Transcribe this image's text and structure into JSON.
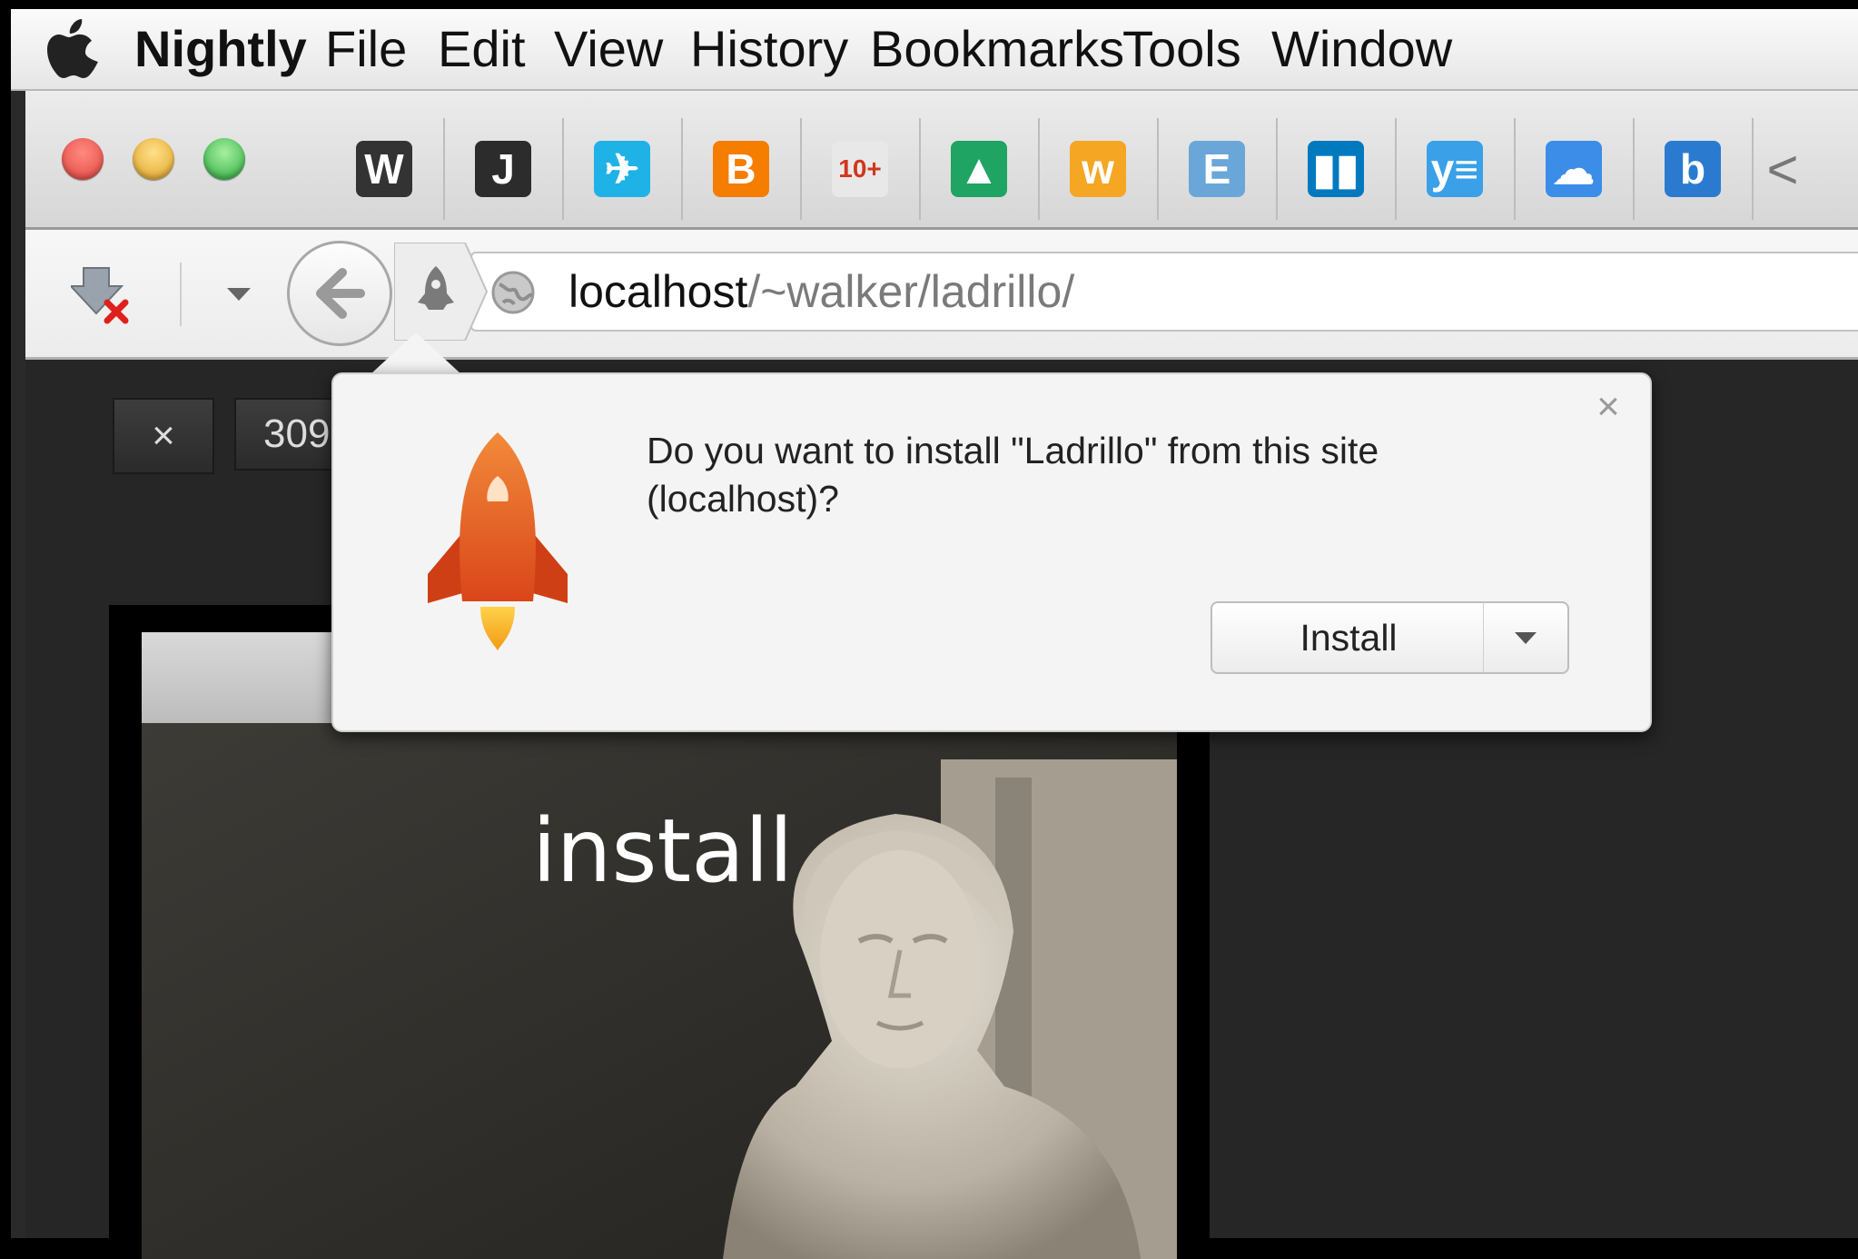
{
  "menubar": {
    "app_name": "Nightly",
    "items": [
      "File",
      "Edit",
      "View",
      "History",
      "Bookmarks",
      "Tools",
      "Window"
    ]
  },
  "toolbar": {
    "bookmarks": [
      {
        "icon": "wikipedia-icon",
        "glyph": "W",
        "color": "#333333"
      },
      {
        "icon": "jsfiddle-icon",
        "glyph": "J",
        "color": "#2c2c2c"
      },
      {
        "icon": "flight-icon",
        "glyph": "✈",
        "color": "#1fb2e6"
      },
      {
        "icon": "blogger-icon",
        "glyph": "B",
        "color": "#f57d00"
      },
      {
        "icon": "calendar-icon",
        "glyph": "10+",
        "color": "#e8e8e8"
      },
      {
        "icon": "google-drive-icon",
        "glyph": "▲",
        "color": "#1fa463"
      },
      {
        "icon": "workday-icon",
        "glyph": "w",
        "color": "#f5a623"
      },
      {
        "icon": "evernote-icon",
        "glyph": "E",
        "color": "#6aa7d8"
      },
      {
        "icon": "trello-icon",
        "glyph": "▮▮",
        "color": "#0079bf"
      },
      {
        "icon": "yammer-icon",
        "glyph": "y≡",
        "color": "#3aa0e8"
      },
      {
        "icon": "cloud-upload-icon",
        "glyph": "☁",
        "color": "#3b8de8"
      },
      {
        "icon": "bing-icon",
        "glyph": "b",
        "color": "#2a7bd0"
      }
    ],
    "overflow_glyph": "<"
  },
  "navbar": {
    "url_host": "localhost",
    "url_path": "/~walker/ladrillo/"
  },
  "page": {
    "close_glyph": "×",
    "counter_partial": "309",
    "heading": "install"
  },
  "popup": {
    "message": "Do you want to install \"Ladrillo\" from this site (localhost)?",
    "close_glyph": "×",
    "install_label": "Install"
  },
  "colors": {
    "accent_rocket": "#e85a1f",
    "traffic_red": "#e0443e",
    "traffic_yellow": "#dea123",
    "traffic_green": "#28a93b"
  }
}
